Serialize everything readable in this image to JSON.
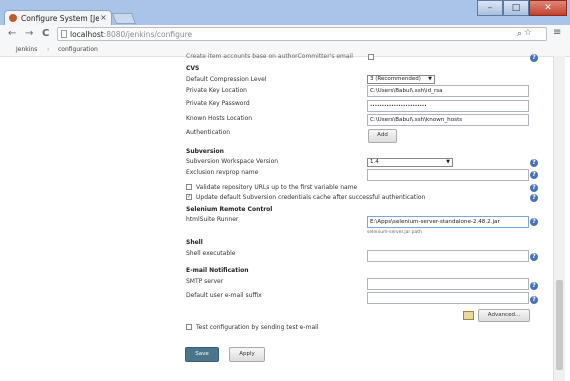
{
  "browser": {
    "tab_title": "Configure System [Je",
    "tab_close": "×",
    "url_host": "localhost",
    "url_path": ":8080/jenkins/configure",
    "win_minimize": "–",
    "win_maximize": "□",
    "win_close": "✕"
  },
  "breadcrumbs": {
    "root": "Jenkins",
    "separator": "›",
    "current": "configuration"
  },
  "top_cutoff": "Create item accounts base on authorCommitter's email",
  "cvs": {
    "header": "CVS",
    "compression_label": "Default Compression Level",
    "compression_value": "3 (Recommended)",
    "key_location_label": "Private Key Location",
    "key_location_value": "C:\\Users\\Babul\\.ssh\\id_rsa",
    "key_password_label": "Private Key Password",
    "key_password_value": "••••••••••••••••••••••••",
    "known_hosts_label": "Known Hosts Location",
    "known_hosts_value": "C:\\Users\\Babul\\.ssh\\known_hosts",
    "auth_label": "Authentication",
    "add_button": "Add"
  },
  "subversion": {
    "header": "Subversion",
    "workspace_label": "Subversion Workspace Version",
    "workspace_value": "1.4",
    "exclusion_label": "Exclusion revprop name",
    "exclusion_value": "",
    "validate_label": "Validate repository URLs up to the first variable name",
    "update_label": "Update default Subversion credentials cache after successful authentication"
  },
  "selenium": {
    "header": "Selenium Remote Control",
    "runner_label": "htmlSuite Runner",
    "runner_value": "E:\\Apps\\selenium-server-standalone-2.48.2.jar",
    "runner_hint": "selenium-server.jar path"
  },
  "shell": {
    "header": "Shell",
    "exec_label": "Shell executable",
    "exec_value": ""
  },
  "email": {
    "header": "E-mail Notification",
    "smtp_label": "SMTP server",
    "smtp_value": "",
    "suffix_label": "Default user e-mail suffix",
    "suffix_value": "",
    "advanced_button": "Advanced...",
    "test_label": "Test configuration by sending test e-mail"
  },
  "actions": {
    "save": "Save",
    "apply": "Apply"
  },
  "icons": {
    "help": "?",
    "back": "←",
    "forward": "→",
    "reload": "C",
    "page": "page-icon",
    "star": "☆",
    "menu": "≡",
    "search": "⌕"
  }
}
